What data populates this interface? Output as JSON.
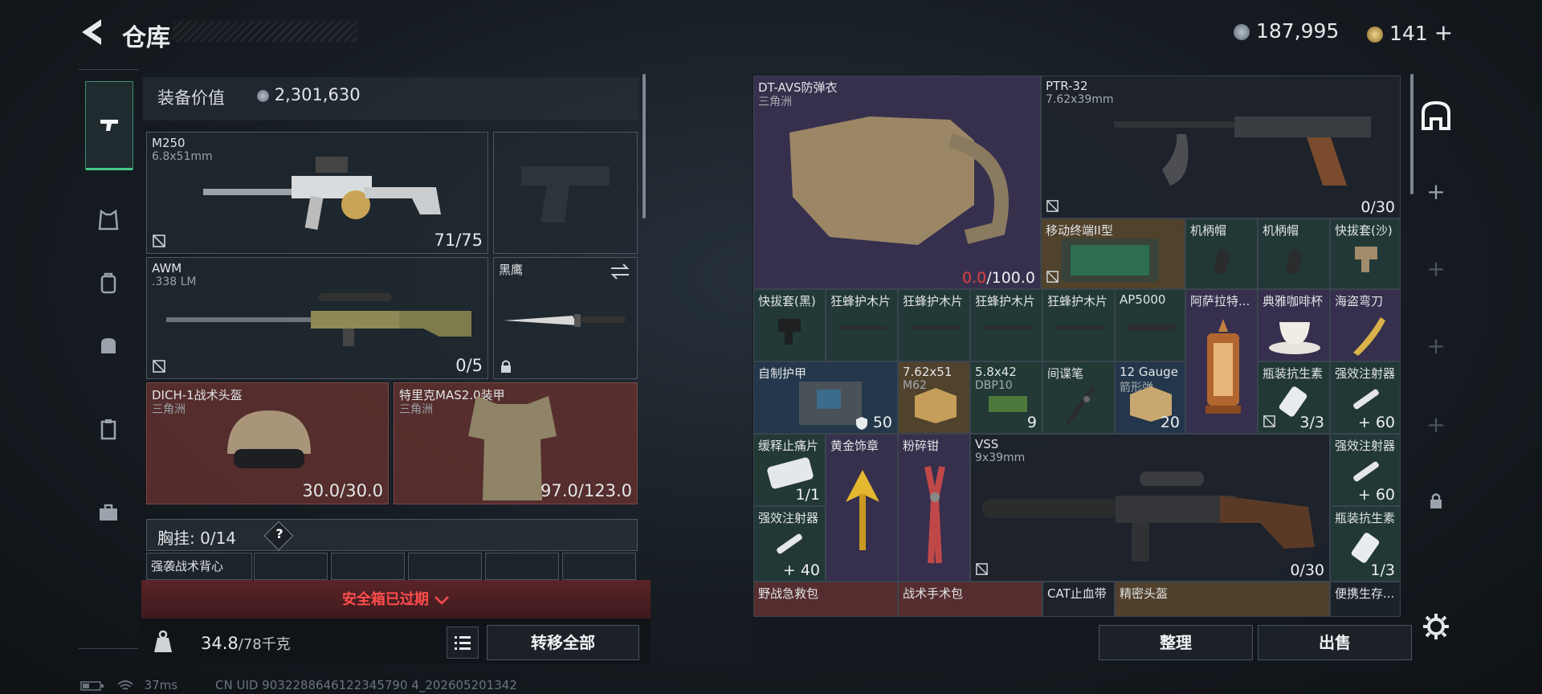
{
  "header": {
    "title": "仓库",
    "currency_primary": "187,995",
    "currency_secondary": "141",
    "currency_add": "+"
  },
  "categories": [
    "weapon-icon",
    "armor-icon",
    "backpack-icon",
    "bag-icon",
    "clipboard-icon",
    "toolbox-icon"
  ],
  "equipment": {
    "value_label": "装备价值",
    "value": "2,301,630",
    "primary": {
      "name": "M250",
      "caliber": "6.8x51mm",
      "ammo": "71/75"
    },
    "secondary": {
      "name": "AWM",
      "caliber": ".338 LM",
      "ammo": "0/5"
    },
    "melee": {
      "name": "黑鹰"
    },
    "helmet": {
      "name": "DICH-1战术头盔",
      "origin": "三角洲",
      "durability": "30.0/30.0"
    },
    "armor": {
      "name": "特里克MAS2.0装甲",
      "origin": "三角洲",
      "durability": "97.0/123.0"
    },
    "chest_label": "胸挂:",
    "chest_count": "0/14",
    "chest_help": "?",
    "pouch_name": "强袭战术背心",
    "safe_box": "安全箱已过期",
    "weight_value": "34.8",
    "weight_max": "/78千克",
    "transfer_all": "转移全部"
  },
  "grid": {
    "vest": {
      "name": "DT-AVS防弹衣",
      "origin": "三角洲",
      "durability_now": "0.0",
      "durability_max": "/100.0"
    },
    "rifle": {
      "name": "PTR-32",
      "caliber": "7.62x39mm",
      "ammo": "0/30"
    },
    "terminal": {
      "name": "移动终端II型"
    },
    "grip1": {
      "name": "机柄帽"
    },
    "grip2": {
      "name": "机柄帽"
    },
    "quickmag_sand": {
      "name": "快拔套(沙)"
    },
    "quickmag_black": {
      "name": "快拔套(黑)"
    },
    "wood1": {
      "name": "狂蜂护木片"
    },
    "wood2": {
      "name": "狂蜂护木片"
    },
    "wood3": {
      "name": "狂蜂护木片"
    },
    "wood4": {
      "name": "狂蜂护木片"
    },
    "ap5000": {
      "name": "AP5000"
    },
    "lantern": {
      "name": "阿萨拉特..."
    },
    "coffee_cup": {
      "name": "典雅咖啡杯"
    },
    "pirate_knife": {
      "name": "海盗弯刀"
    },
    "homemade_armor": {
      "name": "自制护甲",
      "count": "50"
    },
    "ammo_762": {
      "name": "7.62x51",
      "sub": "M62"
    },
    "ammo_58": {
      "name": "5.8x42",
      "sub": "DBP10",
      "count": "9"
    },
    "spy_pen": {
      "name": "间谍笔"
    },
    "ammo_12g": {
      "name": "12 Gauge",
      "sub": "箭形弹",
      "count": "20"
    },
    "antibiotic1": {
      "name": "瓶装抗生素",
      "count": "3/3"
    },
    "injector1": {
      "name": "强效注射器",
      "count": "60"
    },
    "painkiller": {
      "name": "缓释止痛片",
      "count": "1/1"
    },
    "gold_badge": {
      "name": "黄金饰章"
    },
    "pliers": {
      "name": "粉碎钳"
    },
    "vss": {
      "name": "VSS",
      "caliber": "9x39mm",
      "ammo": "0/30"
    },
    "injector2": {
      "name": "强效注射器",
      "count": "60"
    },
    "injector3": {
      "name": "强效注射器",
      "count": "40"
    },
    "antibiotic2": {
      "name": "瓶装抗生素",
      "count": "1/3"
    },
    "first_aid": {
      "name": "野战急救包"
    },
    "surgery_kit": {
      "name": "战术手术包"
    },
    "cat_tourniquet": {
      "name": "CAT止血带"
    },
    "precision_helmet": {
      "name": "精密头盔"
    },
    "survival_kit": {
      "name": "便携生存..."
    }
  },
  "buttons": {
    "sort": "整理",
    "sell": "出售"
  },
  "status": {
    "ping": "37ms",
    "uid": "CN UID 9032288646122345790 4_202605201342"
  },
  "colors": {
    "accent": "#45c58a",
    "danger": "#ff4d4d",
    "vest_low": "#e04040"
  }
}
